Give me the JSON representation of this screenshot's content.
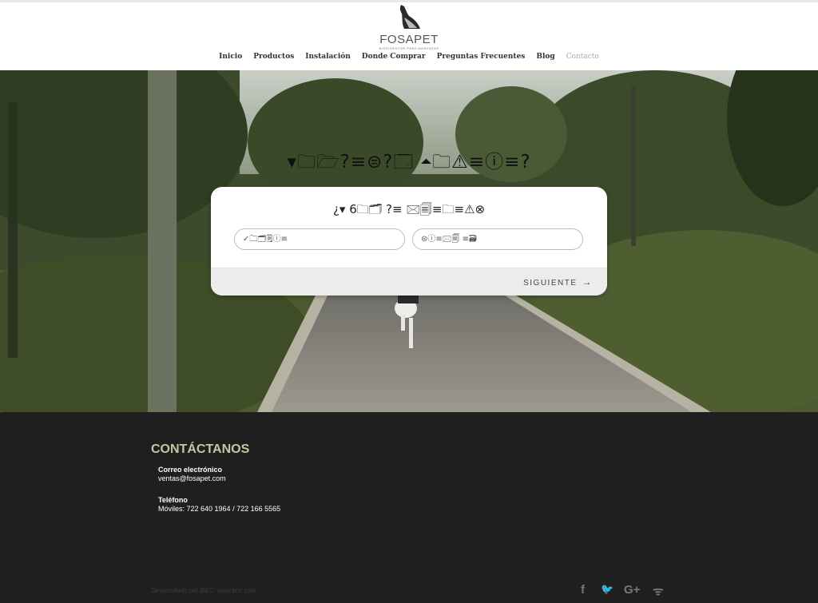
{
  "header": {
    "logo_text": "FOSAPET",
    "logo_tagline": "BIODIGESTOR PARA MASCOTAS",
    "nav": [
      {
        "label": "Inicio"
      },
      {
        "label": "Productos"
      },
      {
        "label": "Instalación"
      },
      {
        "label": "Donde Comprar"
      },
      {
        "label": "Preguntas Frecuentes"
      },
      {
        "label": "Blog"
      },
      {
        "label": "Contacto"
      }
    ]
  },
  "hero": {
    "title": "▾🗀🗁?≡⊜?🗔 ⏶🗀⚠≡ⓘ≡?",
    "form": {
      "question": "¿▾ 6🗀🗂 ?≡ 🖂🗐≡🗀≡⚠⊗",
      "input_left": "✓🗀🗂🗒ⓘ≡",
      "input_right": "⊜ⓘ≡🖂🗐 ≡🗃",
      "next_label": "SIGUIENTE",
      "next_arrow": "→"
    }
  },
  "footer": {
    "contact_title": "CONTÁCTANOS",
    "email_label": "Correo electrónico",
    "email_value": "ventas@fosapet.com",
    "phone_label": "Teléfono",
    "phone_value": "Móviles: 722 640 1964 / 722 166 5565",
    "credit": "Desarrollado por B&C: www.bnc.com",
    "social": [
      {
        "icon": "facebook-icon",
        "glyph": "f"
      },
      {
        "icon": "twitter-icon",
        "glyph": "🐦"
      },
      {
        "icon": "google-plus-icon",
        "glyph": "G+"
      },
      {
        "icon": "rss-icon",
        "glyph": "ᯤ"
      }
    ]
  },
  "colors": {
    "footer_bg": "#1f1f1f",
    "contact_title": "#c8c4a6",
    "card_bg": "#ffffff"
  }
}
